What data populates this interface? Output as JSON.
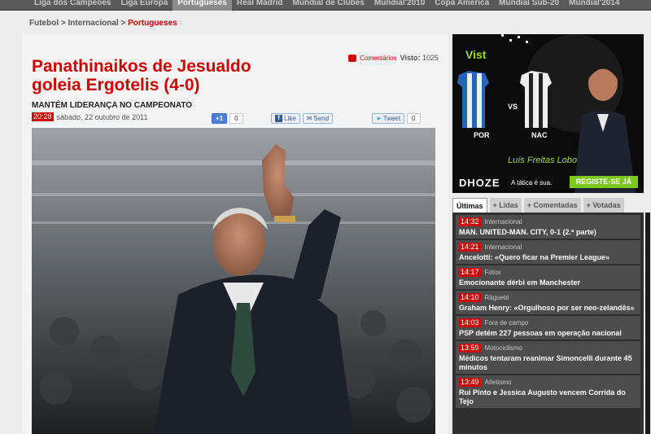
{
  "nav": {
    "items": [
      "Liga dos Campeões",
      "Liga Europa",
      "Portugueses",
      "Real Madrid",
      "Mundial de Clubes",
      "Mundial'2010",
      "Copa América",
      "Mundial Sub-20",
      "Mundial'2014"
    ],
    "active": "Portugueses"
  },
  "breadcrumb": {
    "part1": "Futebol > Internacional > ",
    "current": "Portugueses"
  },
  "article": {
    "title": "Panathinaikos de Jesualdo goleia Ergotelis (4-0)",
    "subtitle": "MANTÉM LIDERANÇA NO CAMPEONATO",
    "time": "20:28",
    "date": "sábado, 22 outubro de 2011",
    "comments_label": "Comentários",
    "views_label": "Visto:",
    "views": "1025"
  },
  "social": {
    "gplus_label": "+1",
    "gplus_count": "0",
    "like_label": "Like",
    "send_label": "Send",
    "tweet_label": "Tweet",
    "tweet_count": "0"
  },
  "ad": {
    "brand": "Vist",
    "team1": "POR",
    "vs": "VS",
    "team2": "NAC",
    "host": "Luís Freitas Lobo",
    "logo": "DHOZE",
    "tagline": "A tática é sua.",
    "cta": "REGISTE-SE JÁ"
  },
  "tabs": [
    "Últimas",
    "+ Lidas",
    "+ Comentadas",
    "+ Votadas"
  ],
  "news": [
    {
      "time": "14:32",
      "category": "Internacional",
      "headline": "MAN. UNITED-MAN. CITY, 0-1 (2.ª parte)"
    },
    {
      "time": "14:21",
      "category": "Internacional",
      "headline": "Ancelotti: «Quero ficar na Premier League»"
    },
    {
      "time": "14:17",
      "category": "Fotos",
      "headline": "Emocionante dérbi em Manchester"
    },
    {
      "time": "14:10",
      "category": "Râguebi",
      "headline": "Graham Henry: «Orgulhoso por ser neo-zelandês»"
    },
    {
      "time": "14:03",
      "category": "Fora de campo",
      "headline": "PSP detém 227 pessoas em operação nacional"
    },
    {
      "time": "13:59",
      "category": "Motociclismo",
      "headline": "Médicos tentaram reanimar Simoncelli durante 45 minutos"
    },
    {
      "time": "13:49",
      "category": "Atletismo",
      "headline": "Rui Pinto e Jessica Augusto vencem Corrida do Tejo"
    }
  ],
  "colors": {
    "accent": "#cc0000",
    "nav_bg": "#5a5a5a",
    "sidebar_bg": "#2f2f2f"
  }
}
